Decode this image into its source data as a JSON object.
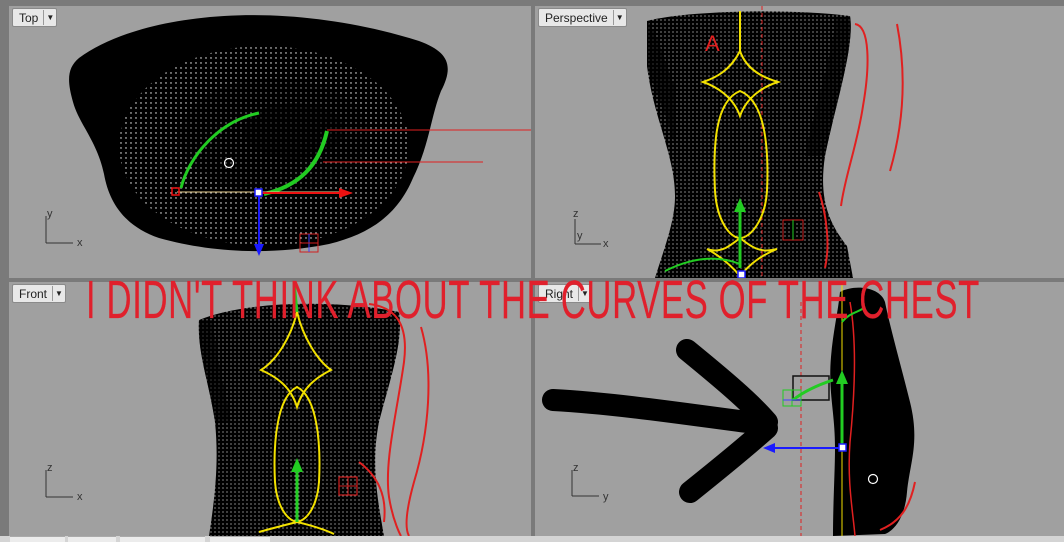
{
  "viewports": {
    "top": {
      "title": "Top",
      "axis_x": "x",
      "axis_y": "y"
    },
    "perspective": {
      "title": "Perspective",
      "axis_x": "x",
      "axis_y": "y",
      "axis_z": "z"
    },
    "front": {
      "title": "Front",
      "axis_x": "x",
      "axis_z": "z"
    },
    "right": {
      "title": "Right",
      "axis_y": "y",
      "axis_z": "z"
    }
  },
  "annotation": {
    "text": "I DIDN'T THINK ABOUT THE CURVES OF THE CHEST",
    "color": "#e0202c"
  },
  "icons": {
    "dropdown": "chevron-down-icon",
    "arrow": "hand-drawn-arrow-icon"
  },
  "colors": {
    "viewport_bg": "#a0a0a0",
    "mesh": "#000000",
    "curve_yellow": "#f2e100",
    "curve_red": "#e02020",
    "gizmo_green": "#22cc22",
    "gizmo_blue": "#1a1aff",
    "gizmo_red": "#ee1111"
  }
}
